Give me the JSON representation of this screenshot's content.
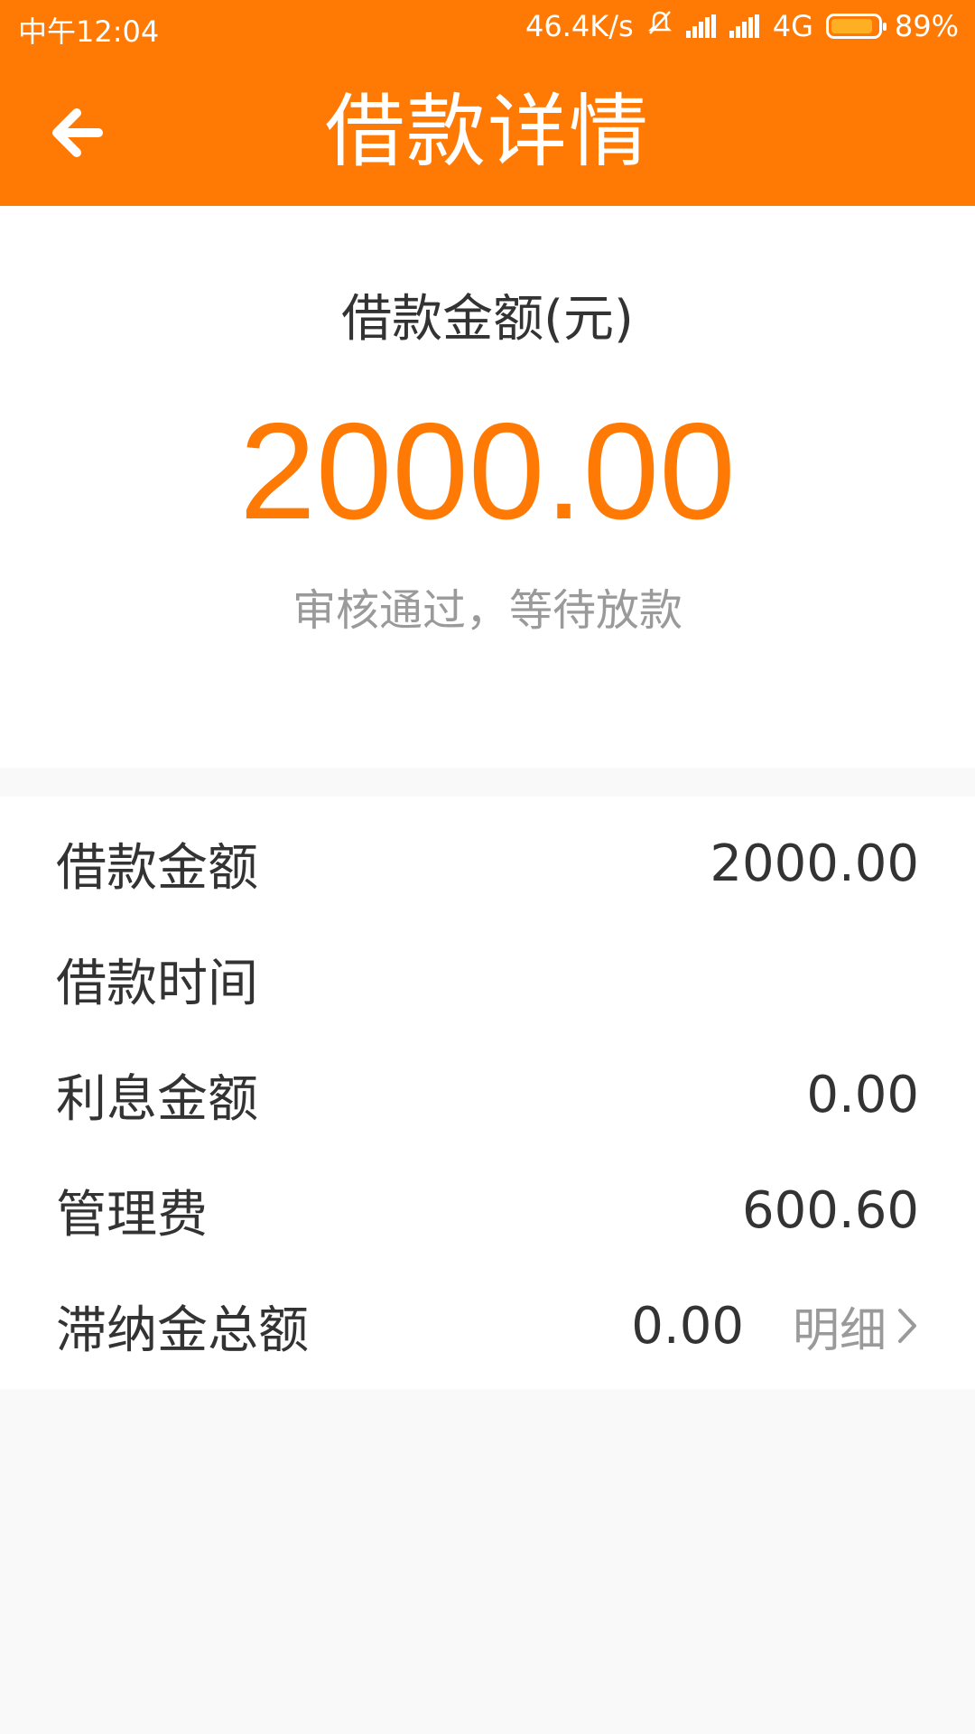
{
  "status_bar": {
    "time": "中午12:04",
    "network_speed": "46.4K/s",
    "network_type": "4G",
    "battery": "89%",
    "battery_level": 0.89
  },
  "header": {
    "title": "借款详情",
    "back_icon": "arrow-left-icon"
  },
  "summary": {
    "label": "借款金额(元)",
    "amount": "2000.00",
    "status": "审核通过，等待放款"
  },
  "details": {
    "rows": [
      {
        "label": "借款金额",
        "value": "2000.00"
      },
      {
        "label": "借款时间",
        "value": ""
      },
      {
        "label": "利息金额",
        "value": "0.00"
      },
      {
        "label": "管理费",
        "value": "600.60"
      },
      {
        "label": "滞纳金总额",
        "value": "0.00"
      }
    ],
    "detail_link": "明细"
  },
  "colors": {
    "accent": "#ff7a04",
    "background": "#f9f9f9",
    "muted": "#9a9a9a"
  }
}
